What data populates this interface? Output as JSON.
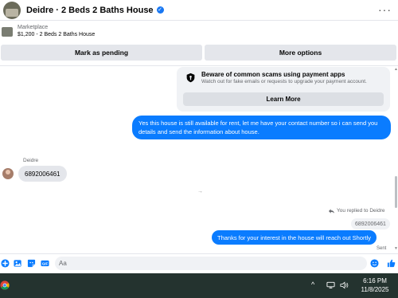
{
  "header": {
    "title": "Deidre · 2 Beds 2 Baths House",
    "more": "···"
  },
  "listing": {
    "source": "Marketplace",
    "title": "$1,200 - 2 Beds 2 Baths House"
  },
  "actions": {
    "mark_pending": "Mark as pending",
    "more_options": "More options"
  },
  "warning": {
    "title": "Beware of common scams using payment apps",
    "subtitle": "Watch out for fake emails or requests to upgrade your payment account.",
    "button": "Learn More"
  },
  "messages": {
    "outgoing_1": "Yes this house is still available for rent, let me have your contact number so i can send you details and send the information about house.",
    "sender_name": "Deidre",
    "incoming_1": "6892006461",
    "center_mark": "→",
    "replied_label": "You replied to Deidre",
    "reply_quote": "6892006461",
    "outgoing_2": "Thanks for your interest in the house will reach out Shortly",
    "status": "Sent"
  },
  "composer": {
    "placeholder": "Aa"
  },
  "taskbar": {
    "time": "6:16 PM",
    "date": "11/8/2025",
    "tray_chevron": "^",
    "colors": {
      "bg": "#24332f"
    }
  },
  "colors": {
    "accent": "#0a7cff",
    "bubble_in": "#e4e6eb",
    "button_bg": "#e4e6eb"
  }
}
